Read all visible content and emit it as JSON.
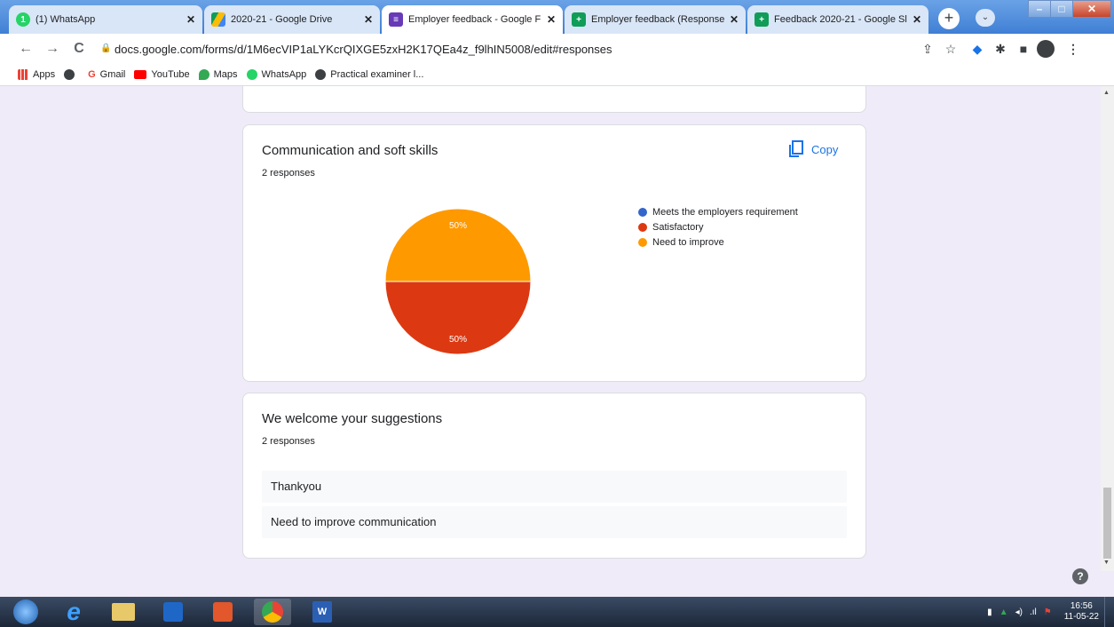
{
  "tabs": [
    {
      "title": "(1) WhatsApp",
      "icon": "whatsapp-icon",
      "badge": "1",
      "color": "#25d366"
    },
    {
      "title": "2020-21 - Google Drive",
      "icon": "google-drive-icon",
      "color": "#fbbc04"
    },
    {
      "title": "Employer feedback - Google F",
      "icon": "google-forms-icon",
      "color": "#673ab7",
      "active": true
    },
    {
      "title": "Employer feedback (Response",
      "icon": "google-sheets-icon",
      "color": "#0f9d58"
    },
    {
      "title": "Feedback 2020-21 - Google Sl",
      "icon": "google-sheets-icon",
      "color": "#0f9d58"
    }
  ],
  "new_tab_label": "+",
  "address": {
    "url": "docs.google.com/forms/d/1M6ecVIP1aLYKcrQIXGE5zxH2K17QEa4z_f9lhIN5008/edit#responses"
  },
  "bookmarks": [
    {
      "label": "Apps",
      "color": "#ea4335"
    },
    {
      "label": "",
      "color": "#3c4043"
    },
    {
      "label": "Gmail",
      "color": "#ea4335"
    },
    {
      "label": "YouTube",
      "color": "#ff0000"
    },
    {
      "label": "Maps",
      "color": "#34a853"
    },
    {
      "label": "WhatsApp",
      "color": "#25d366"
    },
    {
      "label": "Practical examiner l...",
      "color": "#3c4043"
    }
  ],
  "communication": {
    "title": "Communication and soft skills",
    "responses": "2 responses",
    "copy_label": "Copy"
  },
  "chart_data": {
    "type": "pie",
    "title": "",
    "slices": [
      {
        "name": "Meets the employers requirement",
        "value": 0,
        "color": "#3366cc"
      },
      {
        "name": "Satisfactory",
        "value": 50,
        "label": "50%",
        "color": "#dc3912"
      },
      {
        "name": "Need to improve",
        "value": 50,
        "label": "50%",
        "color": "#ff9900"
      }
    ],
    "legend_position": "right"
  },
  "suggestions": {
    "title": "We welcome your suggestions",
    "responses": "2 responses",
    "answers": [
      "Thankyou",
      "Need to improve communication"
    ]
  },
  "clock": {
    "time": "16:56",
    "date": "11-05-22"
  }
}
